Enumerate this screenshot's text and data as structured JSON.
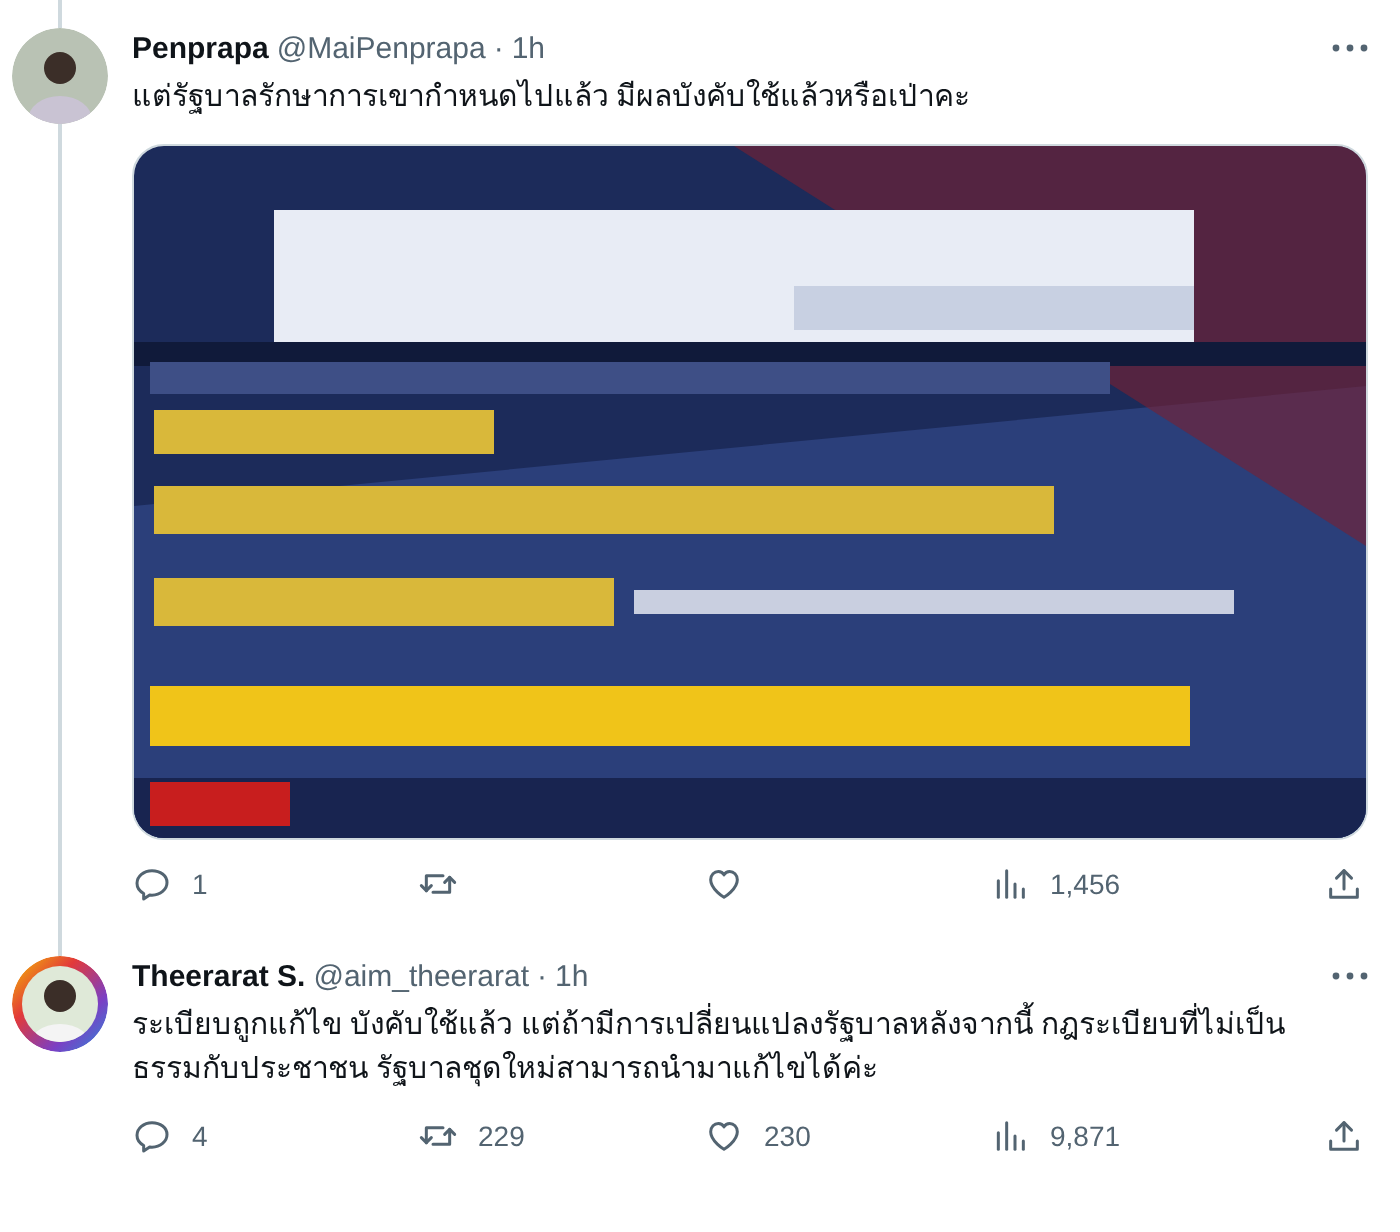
{
  "tweets": [
    {
      "name": "Penprapa",
      "handle": "@MaiPenprapa",
      "separator": "·",
      "time": "1h",
      "text": "แต่รัฐบาลรักษาการเขากำหนดไปแล้ว มีผลบังคับใช้แล้วหรือเป่าคะ",
      "avatar_ring": false,
      "stats": {
        "replies": "1",
        "views": "1,456"
      }
    },
    {
      "name": "Theerarat S.",
      "handle": "@aim_theerarat",
      "separator": "·",
      "time": "1h",
      "text": "ระเบียบถูกแก้ไข บังคับใช้แล้ว แต่ถ้ามีการเปลี่ยนแปลงรัฐบาลหลังจากนี้ กฎระเบียบที่ไม่เป็นธรรมกับประชาชน รัฐบาลชุดใหม่สามารถนำมาแก้ไขได้ค่ะ",
      "avatar_ring": true,
      "stats": {
        "replies": "4",
        "reposts": "229",
        "likes": "230",
        "views": "9,871"
      }
    }
  ]
}
